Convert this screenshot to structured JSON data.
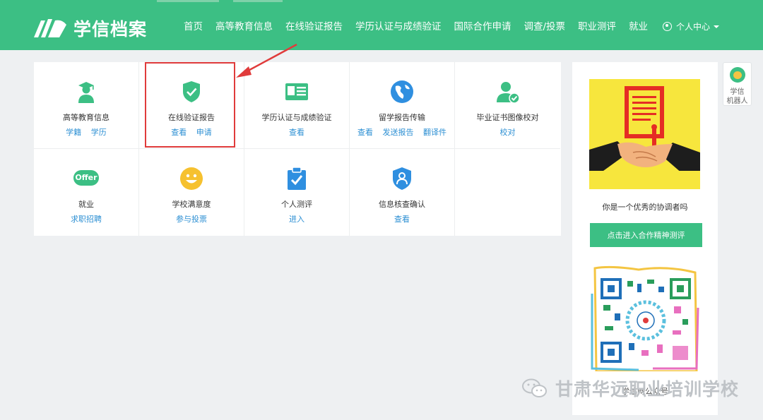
{
  "brand": {
    "logo_text": "学信档案"
  },
  "nav": {
    "items": [
      "首页",
      "高等教育信息",
      "在线验证报告",
      "学历认证与成绩验证",
      "国际合作申请",
      "调查/投票",
      "职业测评",
      "就业"
    ],
    "user_menu": "个人中心"
  },
  "tiles": [
    {
      "name": "高等教育信息",
      "links": [
        "学籍",
        "学历"
      ],
      "icon": "graduate-icon"
    },
    {
      "name": "在线验证报告",
      "links": [
        "查看",
        "申请"
      ],
      "icon": "shield-check-icon"
    },
    {
      "name": "学历认证与成绩验证",
      "links": [
        "查看"
      ],
      "icon": "id-card-icon"
    },
    {
      "name": "留学报告传输",
      "links": [
        "查看",
        "发送报告",
        "翻译件"
      ],
      "icon": "globe-icon"
    },
    {
      "name": "毕业证书图像校对",
      "links": [
        "校对"
      ],
      "icon": "user-check-icon"
    },
    {
      "name": "就业",
      "links": [
        "求职招聘"
      ],
      "icon": "offer-icon"
    },
    {
      "name": "学校满意度",
      "links": [
        "参与投票"
      ],
      "icon": "smiley-icon"
    },
    {
      "name": "个人测评",
      "links": [
        "进入"
      ],
      "icon": "clipboard-check-icon"
    },
    {
      "name": "信息核查确认",
      "links": [
        "查看"
      ],
      "icon": "user-shield-icon"
    }
  ],
  "offer_badge": "Offer",
  "sidebar": {
    "caption": "你是一个优秀的协调者吗",
    "button": "点击进入合作精神测评",
    "qr_label": "学信网公众号"
  },
  "robot": {
    "line1": "学信",
    "line2": "机器人"
  },
  "watermark": "甘肃华远职业培训学校",
  "colors": {
    "brand_green": "#3cbf84",
    "link_blue": "#2c8fd3",
    "highlight_red": "#e03b3b"
  }
}
